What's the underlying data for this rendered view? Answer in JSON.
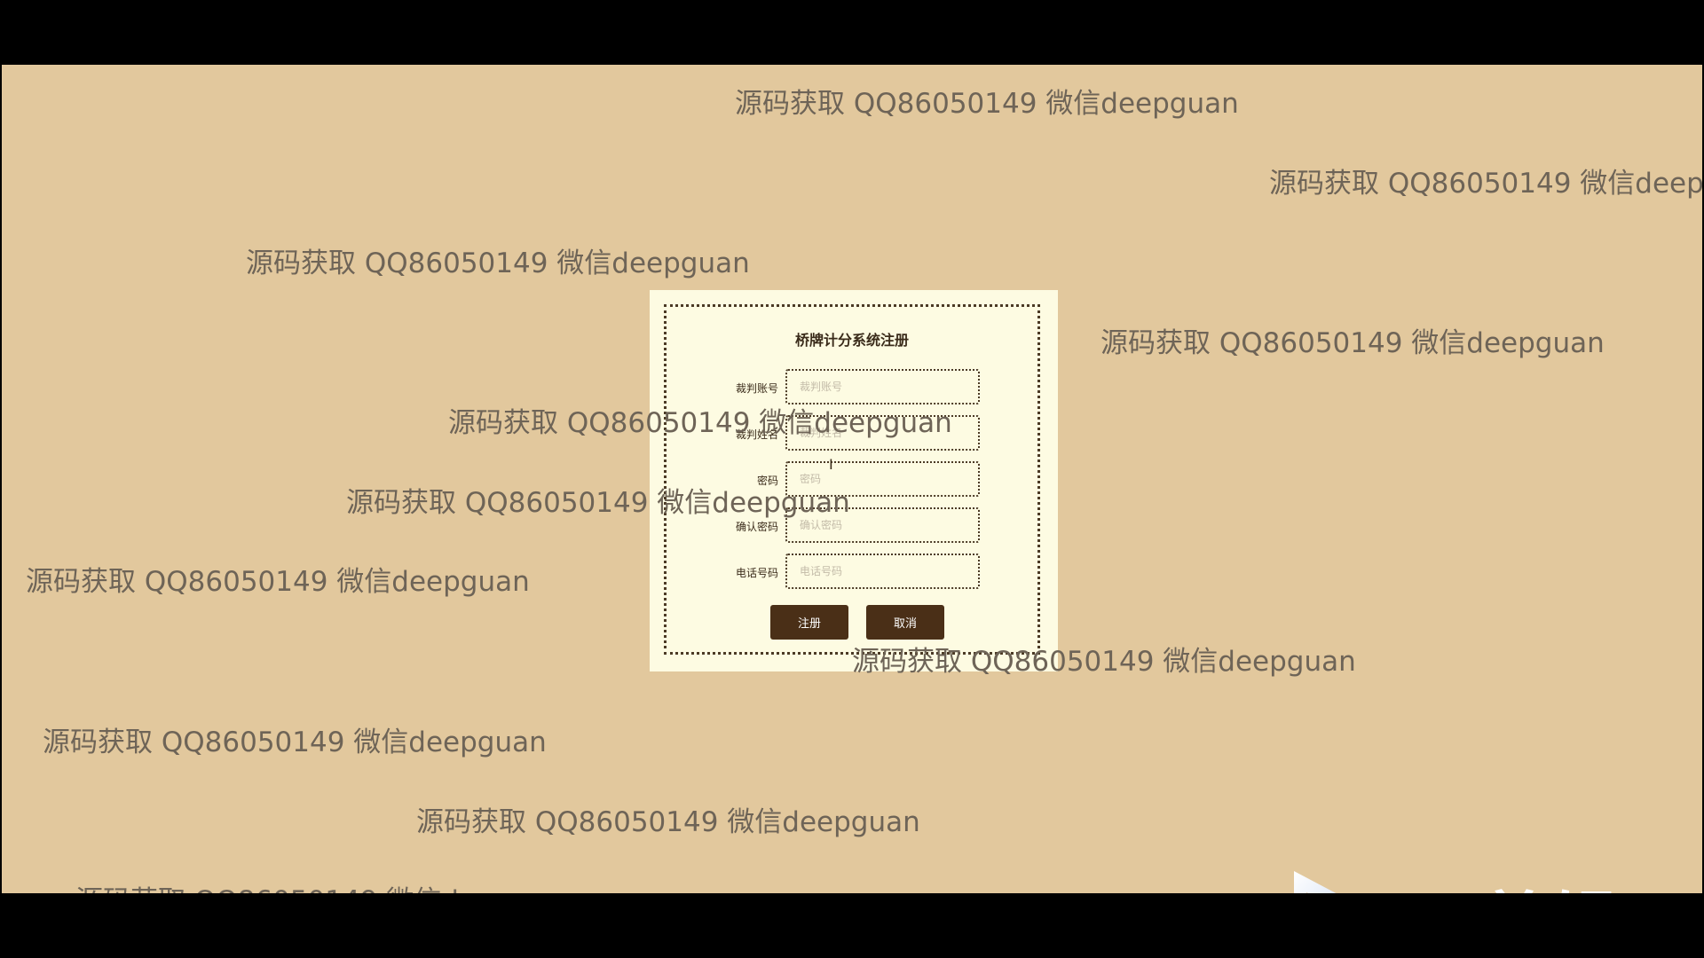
{
  "form": {
    "title": "桥牌计分系统注册",
    "fields": [
      {
        "label": "裁判账号",
        "placeholder": "裁判账号"
      },
      {
        "label": "裁判姓名",
        "placeholder": "裁判姓名"
      },
      {
        "label": "密码",
        "placeholder": "密码"
      },
      {
        "label": "确认密码",
        "placeholder": "确认密码"
      },
      {
        "label": "电话号码",
        "placeholder": "电话号码"
      }
    ],
    "register_label": "注册",
    "cancel_label": "取消"
  },
  "watermark_text": "源码获取 QQ86050149 微信deepguan",
  "logo_text": "eV剪辑",
  "colors": {
    "background": "#e2c89d",
    "card": "#fdfbe2",
    "button": "#4a2f17",
    "watermark": "#6e6457"
  },
  "icons": {
    "cursor": "text-cursor-icon",
    "logo": "play-logo-icon"
  }
}
